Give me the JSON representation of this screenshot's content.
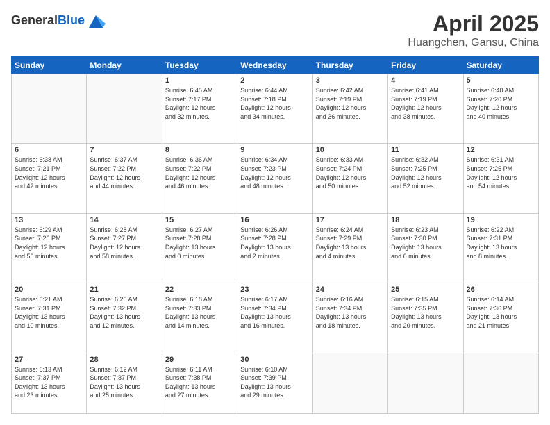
{
  "logo": {
    "general": "General",
    "blue": "Blue"
  },
  "header": {
    "month": "April 2025",
    "location": "Huangchen, Gansu, China"
  },
  "weekdays": [
    "Sunday",
    "Monday",
    "Tuesday",
    "Wednesday",
    "Thursday",
    "Friday",
    "Saturday"
  ],
  "weeks": [
    [
      {
        "day": "",
        "info": ""
      },
      {
        "day": "",
        "info": ""
      },
      {
        "day": "1",
        "info": "Sunrise: 6:45 AM\nSunset: 7:17 PM\nDaylight: 12 hours\nand 32 minutes."
      },
      {
        "day": "2",
        "info": "Sunrise: 6:44 AM\nSunset: 7:18 PM\nDaylight: 12 hours\nand 34 minutes."
      },
      {
        "day": "3",
        "info": "Sunrise: 6:42 AM\nSunset: 7:19 PM\nDaylight: 12 hours\nand 36 minutes."
      },
      {
        "day": "4",
        "info": "Sunrise: 6:41 AM\nSunset: 7:19 PM\nDaylight: 12 hours\nand 38 minutes."
      },
      {
        "day": "5",
        "info": "Sunrise: 6:40 AM\nSunset: 7:20 PM\nDaylight: 12 hours\nand 40 minutes."
      }
    ],
    [
      {
        "day": "6",
        "info": "Sunrise: 6:38 AM\nSunset: 7:21 PM\nDaylight: 12 hours\nand 42 minutes."
      },
      {
        "day": "7",
        "info": "Sunrise: 6:37 AM\nSunset: 7:22 PM\nDaylight: 12 hours\nand 44 minutes."
      },
      {
        "day": "8",
        "info": "Sunrise: 6:36 AM\nSunset: 7:22 PM\nDaylight: 12 hours\nand 46 minutes."
      },
      {
        "day": "9",
        "info": "Sunrise: 6:34 AM\nSunset: 7:23 PM\nDaylight: 12 hours\nand 48 minutes."
      },
      {
        "day": "10",
        "info": "Sunrise: 6:33 AM\nSunset: 7:24 PM\nDaylight: 12 hours\nand 50 minutes."
      },
      {
        "day": "11",
        "info": "Sunrise: 6:32 AM\nSunset: 7:25 PM\nDaylight: 12 hours\nand 52 minutes."
      },
      {
        "day": "12",
        "info": "Sunrise: 6:31 AM\nSunset: 7:25 PM\nDaylight: 12 hours\nand 54 minutes."
      }
    ],
    [
      {
        "day": "13",
        "info": "Sunrise: 6:29 AM\nSunset: 7:26 PM\nDaylight: 12 hours\nand 56 minutes."
      },
      {
        "day": "14",
        "info": "Sunrise: 6:28 AM\nSunset: 7:27 PM\nDaylight: 12 hours\nand 58 minutes."
      },
      {
        "day": "15",
        "info": "Sunrise: 6:27 AM\nSunset: 7:28 PM\nDaylight: 13 hours\nand 0 minutes."
      },
      {
        "day": "16",
        "info": "Sunrise: 6:26 AM\nSunset: 7:28 PM\nDaylight: 13 hours\nand 2 minutes."
      },
      {
        "day": "17",
        "info": "Sunrise: 6:24 AM\nSunset: 7:29 PM\nDaylight: 13 hours\nand 4 minutes."
      },
      {
        "day": "18",
        "info": "Sunrise: 6:23 AM\nSunset: 7:30 PM\nDaylight: 13 hours\nand 6 minutes."
      },
      {
        "day": "19",
        "info": "Sunrise: 6:22 AM\nSunset: 7:31 PM\nDaylight: 13 hours\nand 8 minutes."
      }
    ],
    [
      {
        "day": "20",
        "info": "Sunrise: 6:21 AM\nSunset: 7:31 PM\nDaylight: 13 hours\nand 10 minutes."
      },
      {
        "day": "21",
        "info": "Sunrise: 6:20 AM\nSunset: 7:32 PM\nDaylight: 13 hours\nand 12 minutes."
      },
      {
        "day": "22",
        "info": "Sunrise: 6:18 AM\nSunset: 7:33 PM\nDaylight: 13 hours\nand 14 minutes."
      },
      {
        "day": "23",
        "info": "Sunrise: 6:17 AM\nSunset: 7:34 PM\nDaylight: 13 hours\nand 16 minutes."
      },
      {
        "day": "24",
        "info": "Sunrise: 6:16 AM\nSunset: 7:34 PM\nDaylight: 13 hours\nand 18 minutes."
      },
      {
        "day": "25",
        "info": "Sunrise: 6:15 AM\nSunset: 7:35 PM\nDaylight: 13 hours\nand 20 minutes."
      },
      {
        "day": "26",
        "info": "Sunrise: 6:14 AM\nSunset: 7:36 PM\nDaylight: 13 hours\nand 21 minutes."
      }
    ],
    [
      {
        "day": "27",
        "info": "Sunrise: 6:13 AM\nSunset: 7:37 PM\nDaylight: 13 hours\nand 23 minutes."
      },
      {
        "day": "28",
        "info": "Sunrise: 6:12 AM\nSunset: 7:37 PM\nDaylight: 13 hours\nand 25 minutes."
      },
      {
        "day": "29",
        "info": "Sunrise: 6:11 AM\nSunset: 7:38 PM\nDaylight: 13 hours\nand 27 minutes."
      },
      {
        "day": "30",
        "info": "Sunrise: 6:10 AM\nSunset: 7:39 PM\nDaylight: 13 hours\nand 29 minutes."
      },
      {
        "day": "",
        "info": ""
      },
      {
        "day": "",
        "info": ""
      },
      {
        "day": "",
        "info": ""
      }
    ]
  ]
}
